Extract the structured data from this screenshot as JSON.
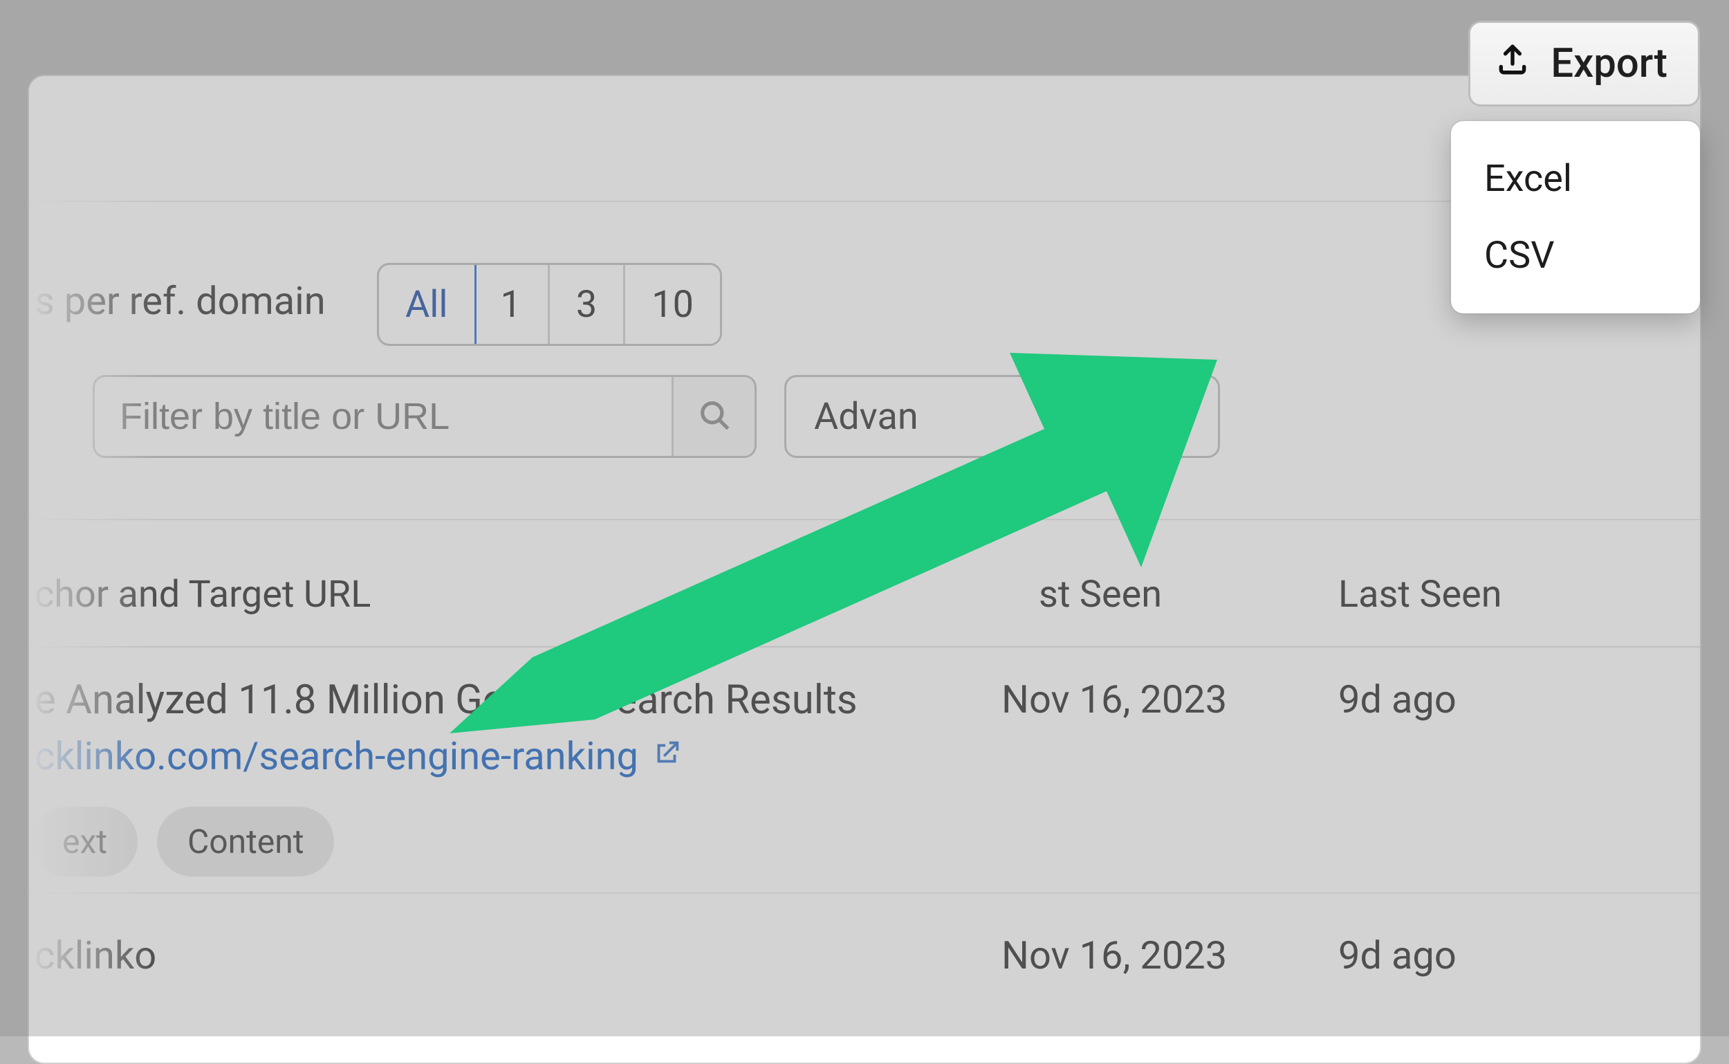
{
  "export": {
    "button_label": "Export",
    "menu": {
      "excel": "Excel",
      "csv": "CSV"
    }
  },
  "filters": {
    "per_ref_domain_label": "s per ref. domain",
    "segments": [
      "All",
      "1",
      "3",
      "10"
    ],
    "filter_placeholder": "Filter by title or URL",
    "advanced_label": "Advan"
  },
  "table": {
    "headers": {
      "anchor": "chor and Target URL",
      "first_seen": "st Seen",
      "last_seen": "Last Seen"
    },
    "rows": [
      {
        "title": "e Analyzed 11.8 Million Google Search Results",
        "url": "cklinko.com/search-engine-ranking",
        "badges": [
          "ext",
          "Content"
        ],
        "first_seen": "Nov 16, 2023",
        "last_seen": "9d ago"
      },
      {
        "title": "cklinko",
        "first_seen": "Nov 16, 2023",
        "last_seen": "9d ago"
      }
    ]
  },
  "annotation": {
    "arrow_color": "#1fc97d"
  }
}
